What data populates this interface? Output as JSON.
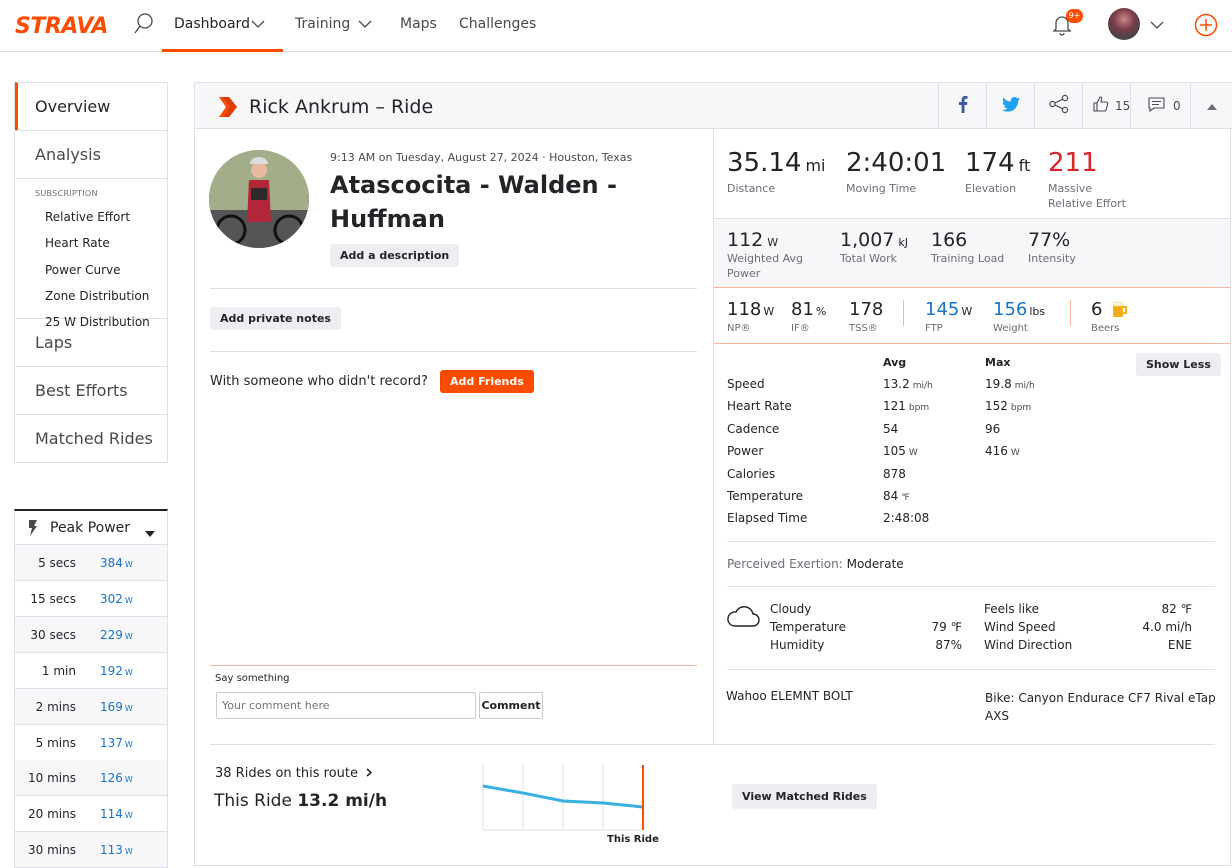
{
  "header": {
    "logo": "STRAVA",
    "nav": [
      "Dashboard",
      "Training",
      "Maps",
      "Challenges"
    ],
    "notification_badge": "9+"
  },
  "sidebar": {
    "items_top": [
      "Overview",
      "Analysis"
    ],
    "subscription_label": "SUBSCRIPTION",
    "subscription_items": [
      "Relative Effort",
      "Heart Rate",
      "Power Curve",
      "Zone Distribution",
      "25 W Distribution"
    ],
    "items_bottom": [
      "Laps",
      "Best Efforts",
      "Matched Rides"
    ]
  },
  "peak_power": {
    "title": "Peak Power",
    "unit": "W",
    "rows": [
      {
        "label": "5 secs",
        "value": "384"
      },
      {
        "label": "15 secs",
        "value": "302"
      },
      {
        "label": "30 secs",
        "value": "229"
      },
      {
        "label": "1 min",
        "value": "192"
      },
      {
        "label": "2 mins",
        "value": "169"
      },
      {
        "label": "5 mins",
        "value": "137"
      },
      {
        "label": "10 mins",
        "value": "126"
      },
      {
        "label": "20 mins",
        "value": "114"
      },
      {
        "label": "30 mins",
        "value": "113"
      }
    ]
  },
  "activity": {
    "title_bar": "Rick Ankrum – Ride",
    "kudos": "15",
    "comments": "0",
    "datetime_location": "9:13 AM on Tuesday, August 27, 2024 · Houston, Texas",
    "name_line1": "Atascocita - Walden -",
    "name_line2": "Huffman",
    "add_description": "Add a description",
    "add_private_notes": "Add private notes",
    "with_someone": "With someone who didn't record?",
    "add_friends": "Add Friends",
    "say_something": "Say something",
    "comment_placeholder": "Your comment here",
    "comment_button": "Comment"
  },
  "stats": {
    "distance": {
      "value": "35.14",
      "unit": "mi",
      "label": "Distance"
    },
    "moving_time": {
      "value": "2:40:01",
      "label": "Moving Time"
    },
    "elevation": {
      "value": "174",
      "unit": "ft",
      "label": "Elevation"
    },
    "relative_effort": {
      "value": "211",
      "label1": "Massive",
      "label2": "Relative Effort"
    },
    "weighted_power": {
      "value": "112",
      "unit": "W",
      "label1": "Weighted Avg",
      "label2": "Power"
    },
    "total_work": {
      "value": "1,007",
      "unit": "kJ",
      "label": "Total Work"
    },
    "training_load": {
      "value": "166",
      "label": "Training Load"
    },
    "intensity": {
      "value": "77%",
      "label": "Intensity"
    },
    "np": {
      "value": "118",
      "unit": "W",
      "label": "NP®"
    },
    "if": {
      "value": "81",
      "unit": "%",
      "label": "IF®"
    },
    "tss": {
      "value": "178",
      "label": "TSS®"
    },
    "ftp": {
      "value": "145",
      "unit": "W",
      "label": "FTP"
    },
    "weight": {
      "value": "156",
      "unit": "lbs",
      "label": "Weight"
    },
    "beers": {
      "value": "6",
      "label": "Beers"
    }
  },
  "details": {
    "avg_header": "Avg",
    "max_header": "Max",
    "show_less": "Show Less",
    "rows": [
      {
        "label": "Speed",
        "avg": "13.2",
        "avg_unit": "mi/h",
        "max": "19.8",
        "max_unit": "mi/h"
      },
      {
        "label": "Heart Rate",
        "avg": "121",
        "avg_unit": "bpm",
        "max": "152",
        "max_unit": "bpm"
      },
      {
        "label": "Cadence",
        "avg": "54",
        "avg_unit": "",
        "max": "96",
        "max_unit": ""
      },
      {
        "label": "Power",
        "avg": "105",
        "avg_unit": "W",
        "max": "416",
        "max_unit": "W"
      },
      {
        "label": "Calories",
        "avg": "878",
        "avg_unit": "",
        "max": "",
        "max_unit": ""
      },
      {
        "label": "Temperature",
        "avg": "84",
        "avg_unit": "℉",
        "max": "",
        "max_unit": ""
      },
      {
        "label": "Elapsed Time",
        "avg": "2:48:08",
        "avg_unit": "",
        "max": "",
        "max_unit": ""
      }
    ],
    "perceived_exertion_label": "Perceived Exertion:",
    "perceived_exertion_value": "Moderate"
  },
  "weather": {
    "condition": "Cloudy",
    "temperature_label": "Temperature",
    "temperature": "79 ℉",
    "humidity_label": "Humidity",
    "humidity": "87%",
    "feels_like_label": "Feels like",
    "feels_like": "82 ℉",
    "wind_speed_label": "Wind Speed",
    "wind_speed": "4.0 mi/h",
    "wind_direction_label": "Wind Direction",
    "wind_direction": "ENE"
  },
  "gear": {
    "device": "Wahoo ELEMNT BOLT",
    "bike_line1": "Bike: Canyon Endurace CF7 Rival eTap",
    "bike_line2": "AXS"
  },
  "matched": {
    "rides_link": "38 Rides on this route",
    "this_ride_label": "This Ride",
    "this_ride_value": "13.2 mi/h",
    "chart_marker": "This Ride",
    "view_button": "View Matched Rides"
  },
  "colors": {
    "brand": "#fc4c02",
    "link": "#1a73c7",
    "sparkline": "#39b0e0"
  }
}
